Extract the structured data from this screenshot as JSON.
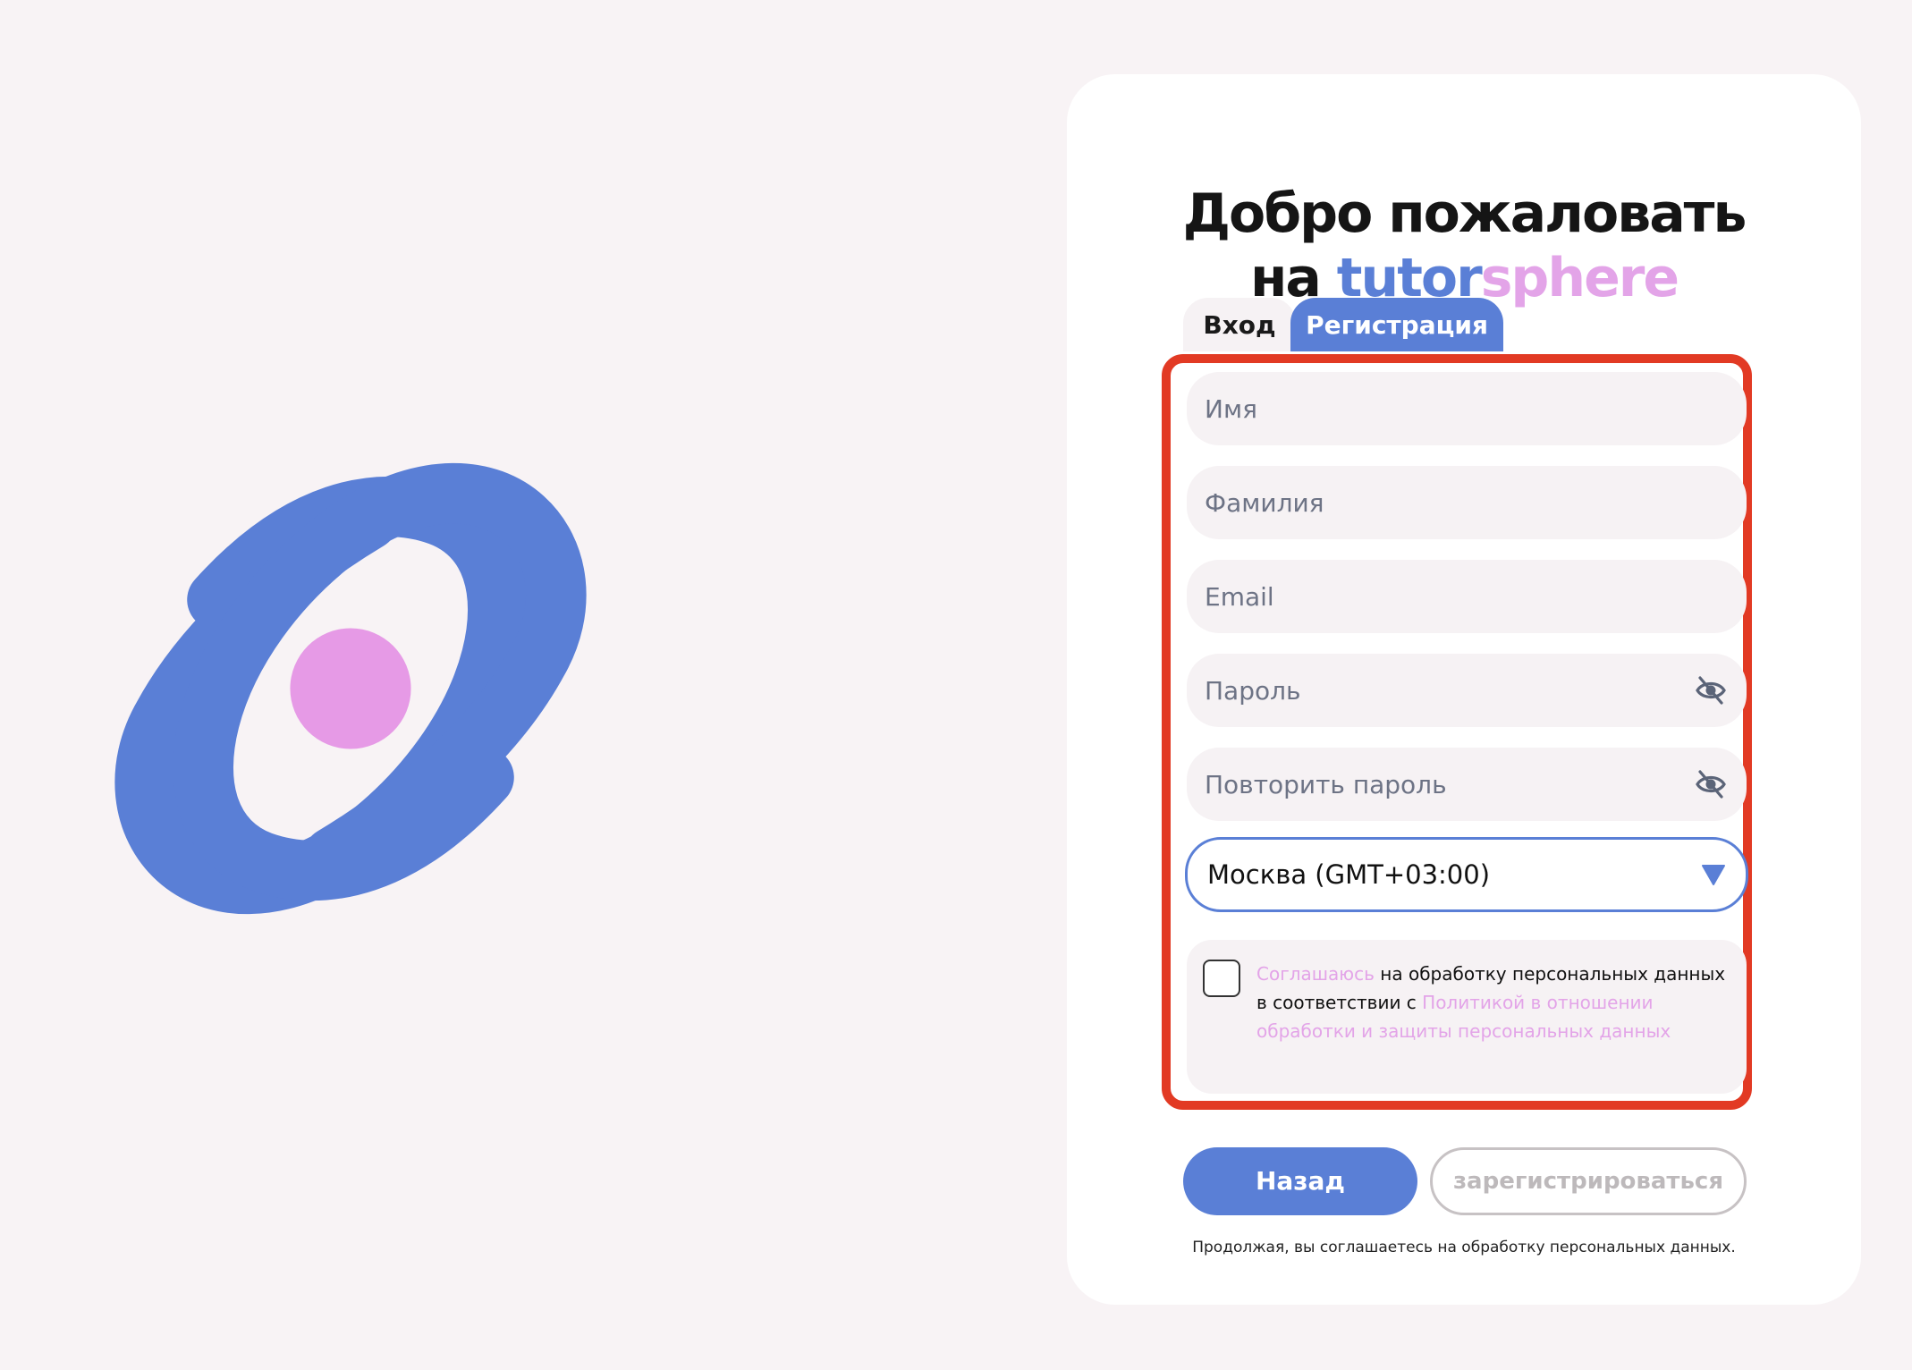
{
  "logo": {
    "icon": "atom-logo-icon",
    "colors": {
      "orbit": "#5a7fd6",
      "nucleus": "#e69ae6"
    }
  },
  "header": {
    "title_line1": "Добро пожаловать",
    "title_prefix": "на",
    "brand_part1": "tutor",
    "brand_part2": "sphere"
  },
  "tabs": [
    {
      "label": "Вход",
      "active": false
    },
    {
      "label": "Регистрация",
      "active": true
    }
  ],
  "form": {
    "first_name": {
      "placeholder": "Имя",
      "value": ""
    },
    "last_name": {
      "placeholder": "Фамилия",
      "value": ""
    },
    "email": {
      "placeholder": "Email",
      "value": ""
    },
    "password": {
      "placeholder": "Пароль",
      "value": "",
      "icon": "eye-off-icon"
    },
    "password_repeat": {
      "placeholder": "Повторить пароль",
      "value": "",
      "icon": "eye-off-icon"
    },
    "timezone": {
      "selected": "Москва (GMT+03:00)",
      "icon": "triangle-down-icon"
    },
    "consent": {
      "checked": false,
      "agree_link": "Соглашаюсь",
      "text1": " на обработку персональных данных в соответствии с ",
      "policy_link": "Политикой в отношении обработки и защиты персональных данных"
    }
  },
  "buttons": {
    "back": "Назад",
    "register": "зарегистрироваться"
  },
  "footnote": "Продолжая, вы соглашаетесь на обработку персональных данных.",
  "colors": {
    "accent_blue": "#5a7fd6",
    "accent_pink": "#e3a4e8",
    "highlight_border": "#e23a24",
    "background": "#f8f3f5"
  }
}
